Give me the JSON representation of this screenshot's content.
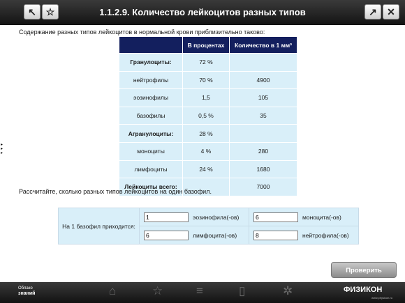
{
  "header": {
    "title": "1.1.2.9. Количество лейкоцитов разных типов",
    "back_icon": "↖",
    "star_icon": "☆",
    "expand_icon": "↗",
    "close_icon": "✕"
  },
  "side_arrows": "▸\n▸\n▸",
  "intro": "Содержание разных типов лейкоцитов в нормальной крови приблизительно таково:",
  "table": {
    "headers": [
      "",
      "В процентах",
      "Количество в 1 мм³"
    ],
    "rows": [
      [
        "Гранулоциты:",
        "72 %",
        ""
      ],
      [
        "нейтрофилы",
        "70 %",
        "4900"
      ],
      [
        "эозинофилы",
        "1,5",
        "105"
      ],
      [
        "базофилы",
        "0,5 %",
        "35"
      ],
      [
        "Агранулоциты:",
        "28 %",
        ""
      ],
      [
        "моноциты",
        "4 %",
        "280"
      ],
      [
        "лимфоциты",
        "24 %",
        "1680"
      ],
      [
        "Лейкоциты всего:",
        "",
        "7000"
      ]
    ]
  },
  "question": "Рассчитайте, сколько разных типов лейкоцитов на один базофил.",
  "answers": {
    "label": "На 1 базофил приходится:",
    "items": [
      {
        "value": "1",
        "unit": "эозинофила(-ов)"
      },
      {
        "value": "6",
        "unit": "моноцита(-ов)"
      },
      {
        "value": "6",
        "unit": "лимфоцита(-ов)"
      },
      {
        "value": "8",
        "unit": "нейтрофила(-ов)"
      }
    ]
  },
  "check_button": "Проверить",
  "bottom": {
    "logo_line1": "Облако",
    "logo_line2": "знаний",
    "fizikon": "ФИЗИКОН",
    "fizikon_url": "www.physicon.ru",
    "icons": [
      "home-icon",
      "star-icon",
      "menu-icon",
      "book-icon",
      "gear-icon"
    ]
  }
}
